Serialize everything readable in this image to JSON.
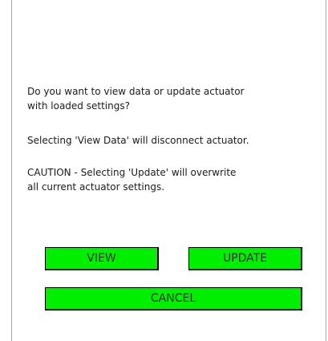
{
  "dialog": {
    "message_line1": "Do you want to view data or update actuator\nwith loaded settings?",
    "message_line2": "Selecting 'View Data' will disconnect actuator.",
    "message_line3": "CAUTION - Selecting 'Update' will overwrite\nall current actuator settings.",
    "buttons": {
      "view": "VIEW",
      "update": "UPDATE",
      "cancel": "CANCEL"
    }
  },
  "colors": {
    "button_fill": "#00ee00",
    "button_border": "#000000",
    "frame_border": "#a6a6a6"
  }
}
